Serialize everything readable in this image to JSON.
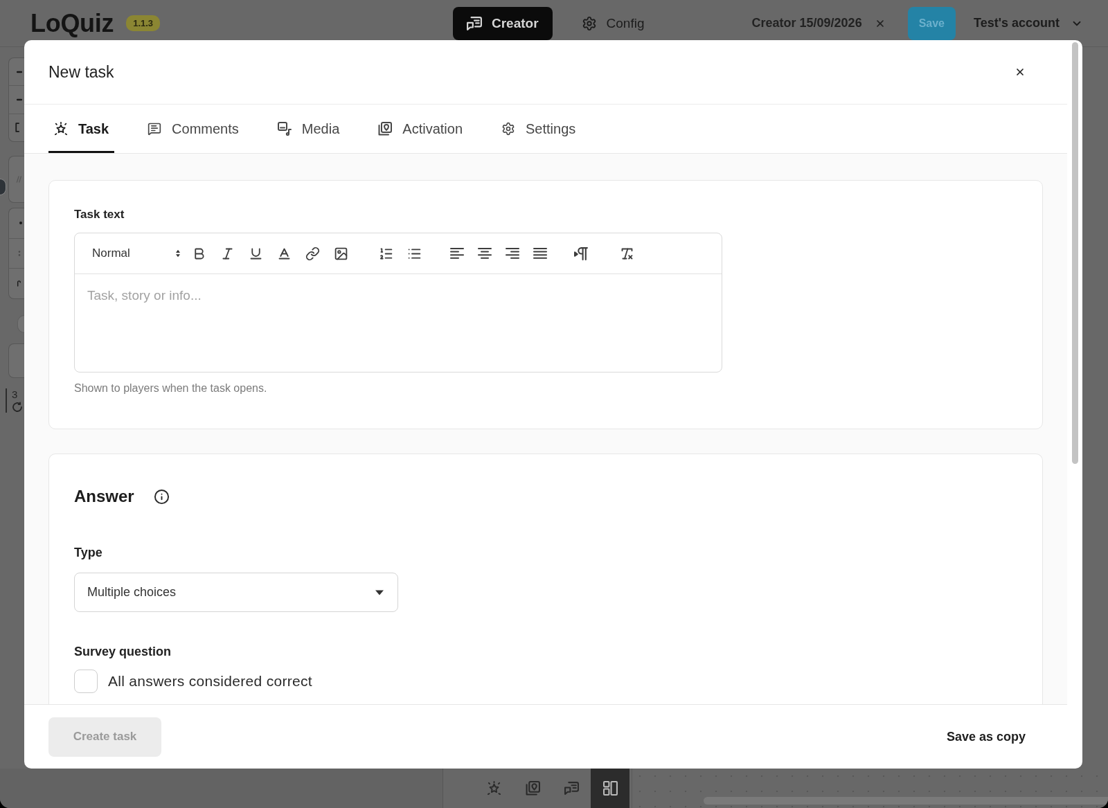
{
  "app_bar": {
    "logo": "LoQuiz",
    "version": "1.1.3",
    "nav": [
      {
        "label": "Creator",
        "kind": "creator",
        "selected": true
      },
      {
        "label": "Config",
        "kind": "config",
        "selected": false
      }
    ],
    "document_tab": "Creator 15/09/2026",
    "save_button": "Save",
    "account": "Test's account"
  },
  "side_tools": {
    "counter": "3"
  },
  "dialog": {
    "title": "New task",
    "tabs": [
      {
        "label": "Task",
        "kind": "task",
        "selected": true
      },
      {
        "label": "Comments",
        "kind": "comments",
        "selected": false
      },
      {
        "label": "Media",
        "kind": "media",
        "selected": false
      },
      {
        "label": "Activation",
        "kind": "activation",
        "selected": false
      },
      {
        "label": "Settings",
        "kind": "settings",
        "selected": false
      }
    ],
    "task_text": {
      "label": "Task text",
      "format": "Normal",
      "placeholder": "Task, story or info...",
      "hint": "Shown to players when the task opens."
    },
    "answer": {
      "heading": "Answer",
      "type_label": "Type",
      "type_value": "Multiple choices",
      "survey_label": "Survey question",
      "survey_option": {
        "label": "All answers considered correct",
        "checked": false
      }
    },
    "footer": {
      "create_button": {
        "label": "Create task",
        "disabled": true
      },
      "copy_button": "Save as copy"
    }
  },
  "bottom_toolbar": [
    {
      "kind": "task",
      "selected": false
    },
    {
      "kind": "activation",
      "selected": false
    },
    {
      "kind": "creator",
      "selected": false
    },
    {
      "kind": "layout",
      "selected": true
    }
  ]
}
